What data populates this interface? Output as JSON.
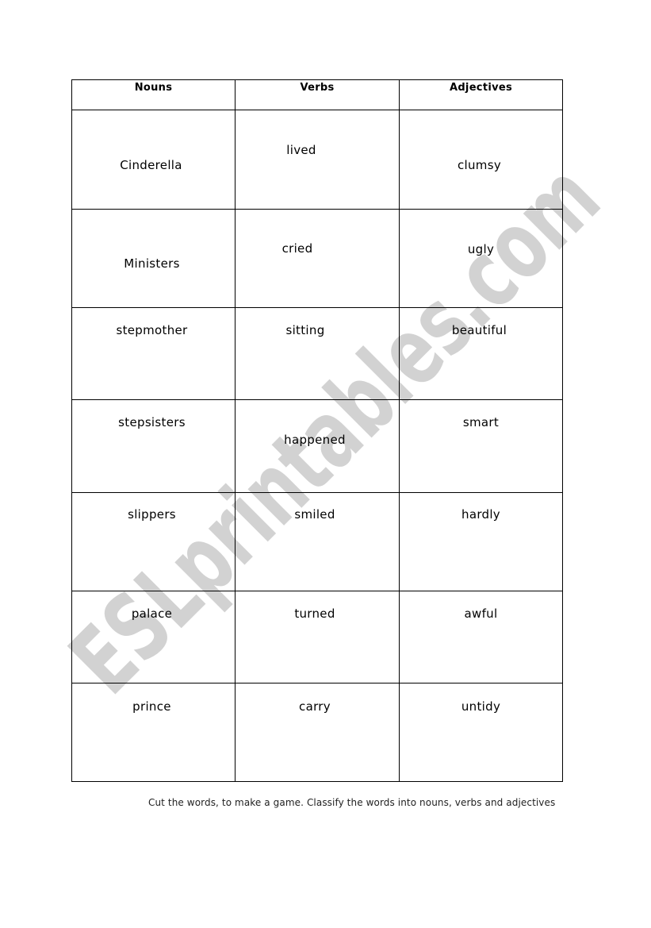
{
  "worksheet": {
    "headers": [
      "Nouns",
      "Verbs",
      "Adjectives"
    ],
    "rows": [
      [
        "Cinderella",
        "lived",
        "clumsy"
      ],
      [
        "Ministers",
        "cried",
        "ugly"
      ],
      [
        "stepmother",
        "sitting",
        "beautiful"
      ],
      [
        "stepsisters",
        "happened",
        "smart"
      ],
      [
        "slippers",
        "smiled",
        "hardly"
      ],
      [
        "palace",
        "turned",
        "awful"
      ],
      [
        "prince",
        "carry",
        "untidy"
      ]
    ],
    "instructions": "Cut the words, to make a game. Classify the words into nouns, verbs and adjectives"
  },
  "watermark": {
    "text": "ESLprintables.com",
    "color": "#d2d2d2"
  },
  "colors": {
    "border": "#000000",
    "text": "#000000",
    "background": "#ffffff"
  }
}
